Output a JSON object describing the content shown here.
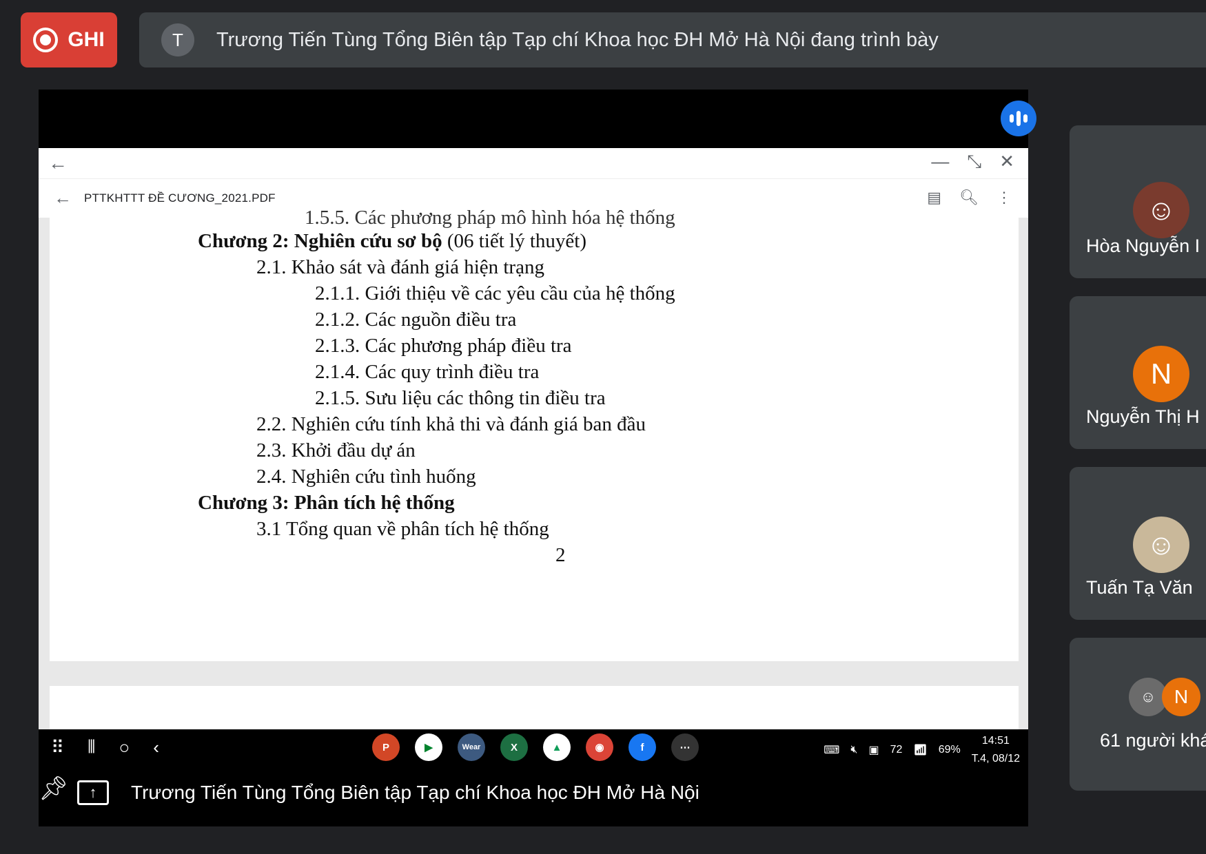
{
  "record_button": {
    "label": "GHI"
  },
  "presenter_banner": {
    "avatar_letter": "T",
    "text": "Trương Tiến Tùng Tổng Biên tập Tạp chí Khoa học ĐH Mở Hà Nội đang trình bày"
  },
  "pdf": {
    "filename": "PTTKHTTT ĐỀ CƯƠNG_2021.PDF",
    "lines": {
      "cut": "1.5.5. Các phương pháp mô hình hóa hệ thống",
      "ch2_bold": "Chương 2: Nghiên cứu sơ bộ",
      "ch2_rest": " (06 tiết lý thuyết)",
      "s21": "2.1. Khảo sát và đánh giá hiện trạng",
      "s211": "2.1.1. Giới thiệu về các yêu cầu của hệ thống",
      "s212": "2.1.2. Các nguồn điều tra",
      "s213": "2.1.3. Các phương pháp điều tra",
      "s214": "2.1.4. Các quy trình điều tra",
      "s215": "2.1.5. Sưu liệu các thông tin điều tra",
      "s22": "2.2. Nghiên cứu tính khả thi và đánh giá ban đầu",
      "s23": "2.3. Khởi đầu dự án",
      "s24": "2.4. Nghiên cứu tình huống",
      "ch3": "Chương 3: Phân tích hệ thống",
      "s31": "3.1 Tổng quan về phân tích hệ thống",
      "page_no": "2"
    }
  },
  "status_bar": {
    "battery": "69%",
    "notif_count": "72",
    "time": "14:51",
    "date": "T.4, 08/12"
  },
  "dock_apps": [
    "powerpoint-icon",
    "meet-icon",
    "wear-icon",
    "excel-icon",
    "drive-icon",
    "chrome-icon",
    "facebook-icon",
    "more-icon"
  ],
  "caption": {
    "text": "Trương Tiến Tùng Tổng Biên tập Tạp chí Khoa học ĐH Mở Hà Nội"
  },
  "participants": [
    {
      "name": "Hòa Nguyễn I"
    },
    {
      "name": "Nguyễn Thị H",
      "initial": "N"
    },
    {
      "name": "Tuấn Tạ Văn"
    },
    {
      "name": "61 người khá",
      "initial": "N"
    }
  ],
  "colors": {
    "record": "#d93f35",
    "audio": "#1a73e8",
    "avatar_orange": "#e8710a",
    "tile_bg": "#3c4043"
  }
}
